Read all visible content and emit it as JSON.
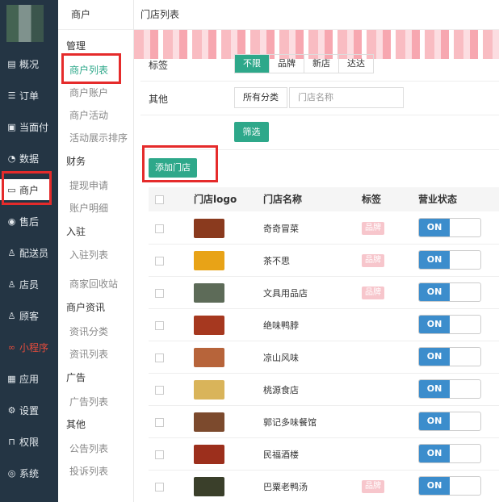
{
  "sidebar": {
    "items": [
      {
        "label": "概况",
        "icon": "chart-icon"
      },
      {
        "label": "订单",
        "icon": "list-icon"
      },
      {
        "label": "当面付",
        "icon": "wallet-icon"
      },
      {
        "label": "数据",
        "icon": "gauge-icon"
      },
      {
        "label": "商户",
        "icon": "store-icon"
      },
      {
        "label": "售后",
        "icon": "aftersale-icon"
      },
      {
        "label": "配送员",
        "icon": "courier-icon"
      },
      {
        "label": "店员",
        "icon": "clerk-icon"
      },
      {
        "label": "顾客",
        "icon": "customer-icon"
      },
      {
        "label": "小程序",
        "icon": "miniapp-icon"
      },
      {
        "label": "应用",
        "icon": "apps-icon"
      },
      {
        "label": "设置",
        "icon": "gear-icon"
      },
      {
        "label": "权限",
        "icon": "lock-icon"
      },
      {
        "label": "系统",
        "icon": "system-icon"
      }
    ]
  },
  "submenu": {
    "title": "商户",
    "groups": [
      {
        "label": "管理",
        "links": [
          "商户列表",
          "商户账户",
          "商户活动",
          "活动展示排序"
        ]
      },
      {
        "label": "财务",
        "links": [
          "提现申请",
          "账户明细"
        ]
      },
      {
        "label": "入驻",
        "links": [
          "入驻列表",
          "商家回收站"
        ]
      },
      {
        "label": "商户资讯",
        "links": [
          "资讯分类",
          "资讯列表"
        ]
      },
      {
        "label": "广告",
        "links": [
          "广告列表"
        ]
      },
      {
        "label": "其他",
        "links": [
          "公告列表",
          "投诉列表"
        ]
      }
    ]
  },
  "main": {
    "title": "门店列表",
    "filter": {
      "tag_label": "标签",
      "tags": [
        "不限",
        "品牌",
        "新店",
        "达达"
      ],
      "other_label": "其他",
      "category": "所有分类",
      "name_placeholder": "门店名称",
      "filter_button": "筛选"
    },
    "add_button": "添加门店",
    "table": {
      "columns": [
        "门店logo",
        "门店名称",
        "标签",
        "营业状态"
      ],
      "rows": [
        {
          "name": "奇奇冒菜",
          "tag": "品牌",
          "status": "ON",
          "logo": "#8a3a1e"
        },
        {
          "name": "茶不思",
          "tag": "品牌",
          "status": "ON",
          "logo": "#e8a317"
        },
        {
          "name": "文具用品店",
          "tag": "品牌",
          "status": "ON",
          "logo": "#5d6b58"
        },
        {
          "name": "绝味鸭脖",
          "tag": "",
          "status": "ON",
          "logo": "#a6381f"
        },
        {
          "name": "凉山风味",
          "tag": "",
          "status": "ON",
          "logo": "#b7643a"
        },
        {
          "name": "桃源食店",
          "tag": "",
          "status": "ON",
          "logo": "#d9b45a"
        },
        {
          "name": "郭记多味餐馆",
          "tag": "",
          "status": "ON",
          "logo": "#7c4a2d"
        },
        {
          "name": "民福酒楼",
          "tag": "",
          "status": "ON",
          "logo": "#9c2f1c"
        },
        {
          "name": "巴粟老鸭汤",
          "tag": "品牌",
          "status": "ON",
          "logo": "#3a3f2a"
        }
      ]
    }
  },
  "colors": {
    "sidebar_bg": "#243544",
    "accent": "#2ea88a",
    "toggle_on": "#3c8dcc",
    "highlight": "#e52b2b"
  }
}
